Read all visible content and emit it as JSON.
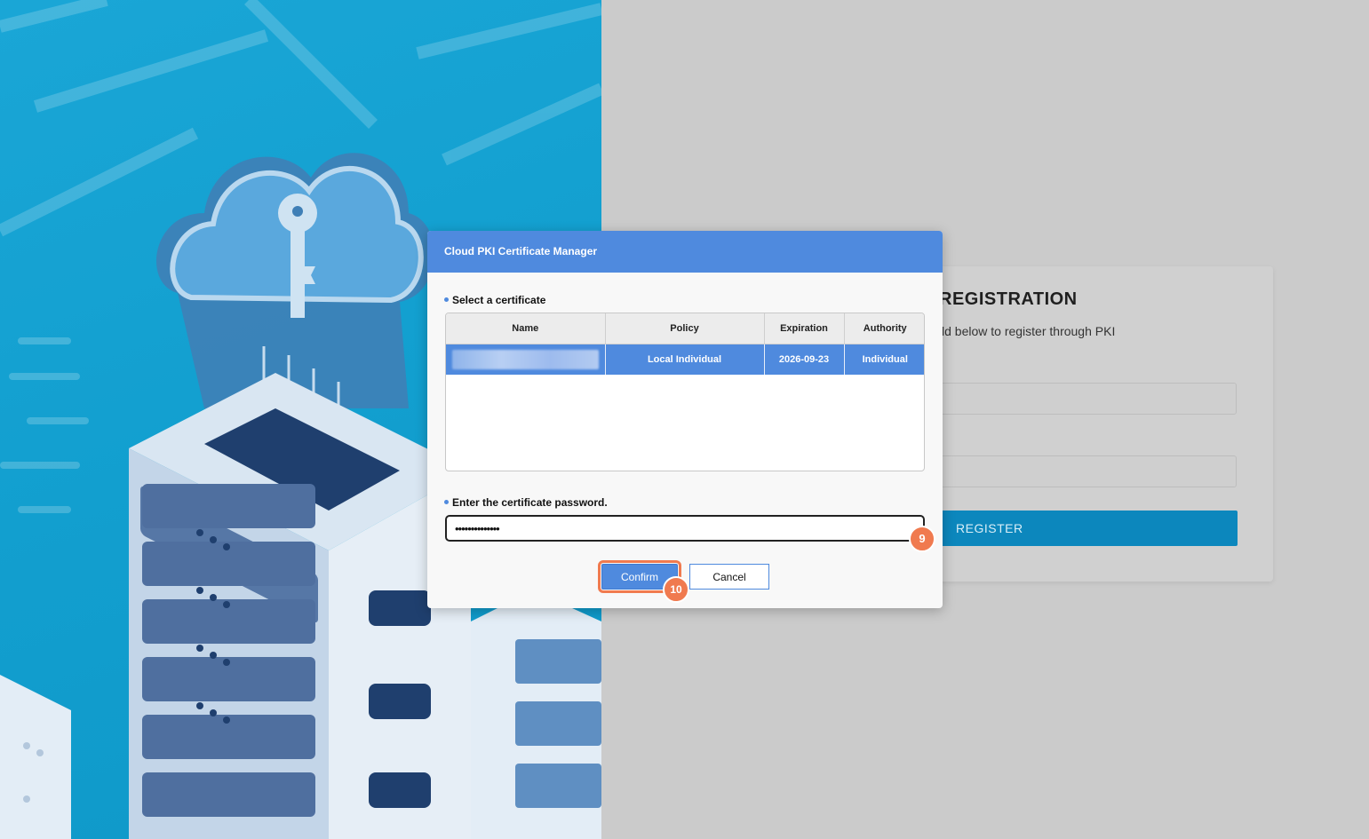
{
  "background": {
    "accent_left": "#129fcf",
    "illustration": "cloud-key-server-illustration"
  },
  "registration": {
    "title": "REGISTRATION",
    "subtitle": "ld below to register through PKI",
    "register_label": "REGISTER"
  },
  "dialog": {
    "title": "Cloud PKI Certificate Manager",
    "select_label": "Select a certificate",
    "columns": [
      "Name",
      "Policy",
      "Expiration",
      "Authority"
    ],
    "rows": [
      {
        "name": "",
        "policy": "Local Individual",
        "expiration": "2026-09-23",
        "authority": "Individual"
      }
    ],
    "password_label": "Enter the certificate password.",
    "password_value": "••••••••••••••",
    "confirm_label": "Confirm",
    "cancel_label": "Cancel"
  },
  "step_badges": {
    "password_step": "9",
    "confirm_step": "10",
    "color": "#f07a4f"
  }
}
